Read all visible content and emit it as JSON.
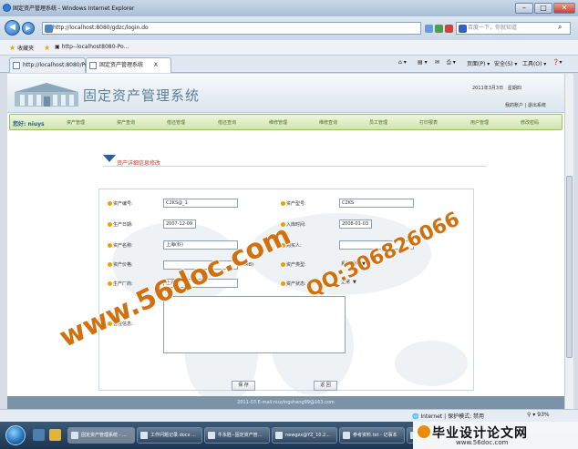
{
  "window": {
    "title": "固定资产管理系统 - Windows Internet Explorer"
  },
  "browser": {
    "address": "http://localhost:8080/gdzc/login.do",
    "search_placeholder": "百度一下，你就知道",
    "favorites_label": "收藏夹",
    "favorite_link": "http--localhost8080-Po...",
    "tabs": [
      {
        "label": "http://localhost:8080/Po..."
      },
      {
        "label": "固定资产管理系统"
      }
    ],
    "tab_close": "X",
    "commands": {
      "page": "页面(P) ▾",
      "safety": "安全(S) ▾",
      "tools": "工具(O) ▾"
    },
    "status": {
      "zone": "Internet | 保护模式: 禁用",
      "zoom": "93%"
    }
  },
  "site": {
    "name": "固定资产管理系统",
    "date": "2011年3月3日",
    "weekday": "星期四",
    "links": "我的账户 | 退出系统"
  },
  "nav": {
    "user": "您好: niuys",
    "items": [
      "资产管理",
      "资产查询",
      "借还管理",
      "借还查询",
      "维修管理",
      "维修查询",
      "员工管理",
      "打印报表",
      "用户管理",
      "修改密码"
    ]
  },
  "form": {
    "section_title": "资产详细信息修改",
    "fields": {
      "asset_no": {
        "label": "资产编号:",
        "value": "C2KS@_1"
      },
      "asset_model": {
        "label": "资产型号:",
        "value": "C2KS"
      },
      "production_date": {
        "label": "生产日期:",
        "value": "2007-12-09"
      },
      "storage_time": {
        "label": "入库时间:",
        "value": "2008-01-03"
      },
      "asset_name": {
        "label": "资产名称:",
        "value": "上海(科)"
      },
      "buyer": {
        "label": "购买人:",
        "value": ""
      },
      "asset_price": {
        "label": "资产价格:",
        "value": "",
        "unit": "(RMB)"
      },
      "asset_type": {
        "label": "资产类型:",
        "value": "系统配件"
      },
      "manufacturer": {
        "label": "生产厂商:",
        "value": "上海"
      },
      "asset_status": {
        "label": "资产状态:",
        "value": "正常"
      },
      "remarks": {
        "label": "备注信息:",
        "value": ""
      }
    },
    "save_label": "保 存",
    "back_label": "返 回"
  },
  "footer": {
    "text": "2011-03 E-mail:niuyingsheng99@163.com"
  },
  "taskbar": {
    "tasks": [
      "固定资产管理系统 - ...",
      "工作问题记录.docx ...",
      "牛永胜--固定资产管...",
      "newgzx@YZ_10.2...",
      "参考资料.txt - 记事本",
      "My"
    ]
  },
  "watermarks": {
    "site": "www.56doc.com",
    "qq": "QQ:306826066",
    "brand": "毕业设计论文网",
    "brand_url": "www.56doc.com"
  },
  "colors": {
    "accent": "#2f5f9a",
    "nav_green": "#cfe5a9",
    "watermark": "#d2700f",
    "section_title": "#c0392b"
  }
}
